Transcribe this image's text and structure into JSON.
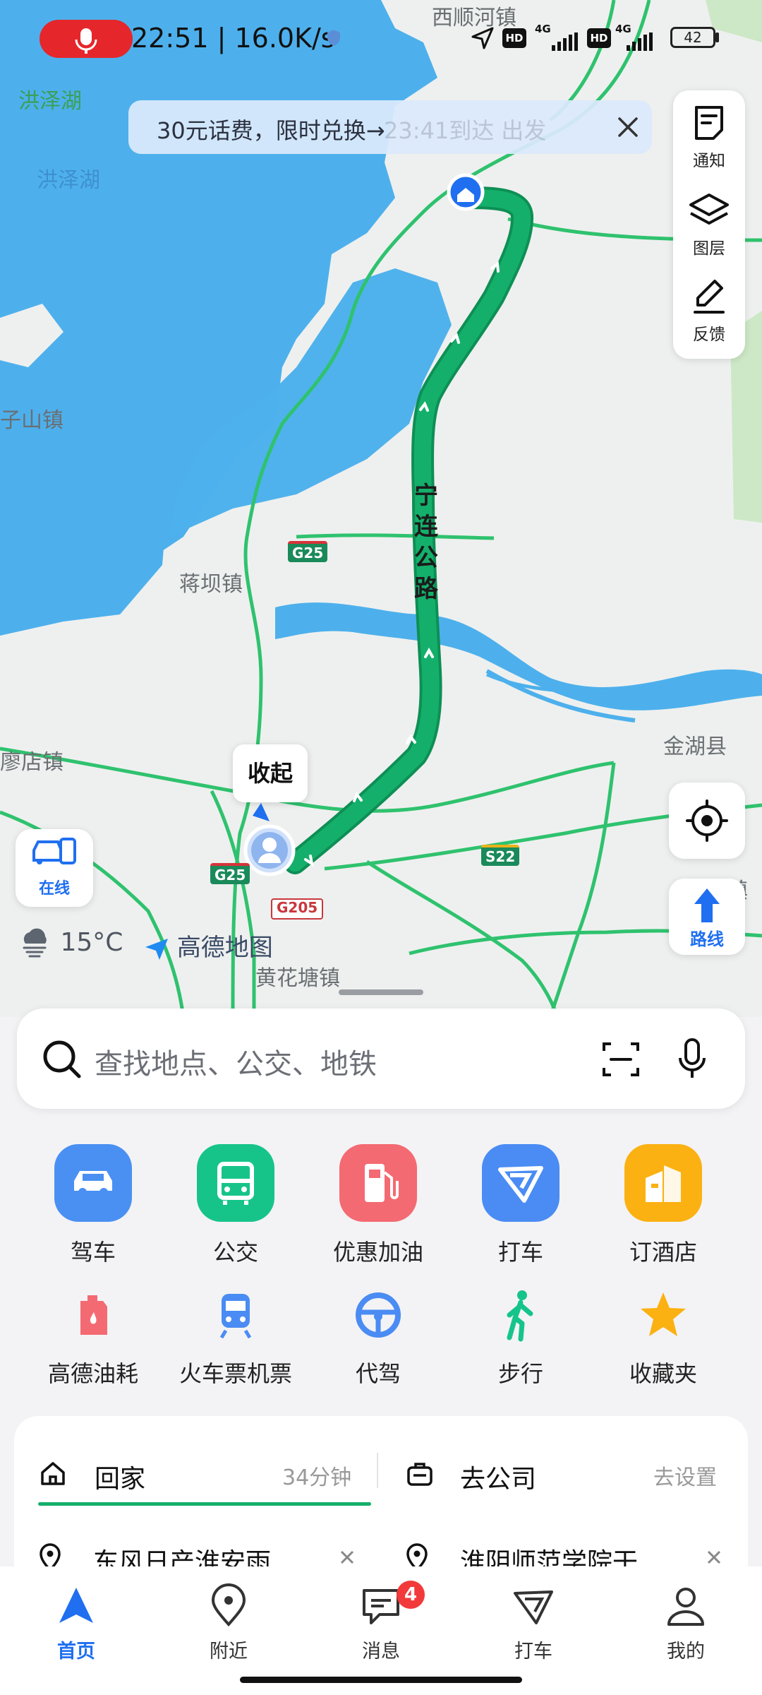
{
  "status_bar": {
    "time_speed": "22:51 | 16.0K/s",
    "network_1": "4G",
    "network_2": "4G",
    "hd_1": "HD",
    "hd_2": "HD",
    "battery": "42"
  },
  "promo": {
    "text": "30元话费，限时兑换→",
    "ghost_text": "23:41到达  出发"
  },
  "map": {
    "labels": {
      "xishunhe": "西顺河镇",
      "hongzehu_green": "洪泽湖",
      "hongzehu": "洪泽湖",
      "ziahan": "子山镇",
      "jiangba": "蒋坝镇",
      "miaodian": "廖店镇",
      "jinhu": "金湖县",
      "huanghuatang": "黄花塘镇",
      "qianjian": "前镇"
    },
    "road_name": [
      "宁",
      "连",
      "公",
      "路"
    ],
    "shields": {
      "g25_top": "G25",
      "g25_bottom": "G25",
      "s22": "S22",
      "g205": "G205"
    },
    "collapse_bubble": "收起",
    "colors": {
      "water": "#4db0ec",
      "route": "#14b06b",
      "route_edge": "#0e8f55",
      "road": "#2fc26e"
    }
  },
  "side_tools": {
    "notice": "通知",
    "layers": "图层",
    "feedback": "反馈",
    "route": "路线",
    "online": "在线"
  },
  "weather": {
    "temp": "15°C",
    "brand": "高德地图",
    "icon": "cloud-rain-icon"
  },
  "search": {
    "placeholder": "查找地点、公交、地铁"
  },
  "quick": {
    "row1": [
      {
        "label": "驾车",
        "icon": "car-icon",
        "color": "#4a90f2"
      },
      {
        "label": "公交",
        "icon": "bus-icon",
        "color": "#16c48a"
      },
      {
        "label": "优惠加油",
        "icon": "fuel-icon",
        "color": "#f46a72"
      },
      {
        "label": "打车",
        "icon": "taxi-icon",
        "color": "#4a8cf3"
      },
      {
        "label": "订酒店",
        "icon": "hotel-icon",
        "color": "#fbb112"
      }
    ],
    "row2": [
      {
        "label": "高德油耗",
        "icon": "fuel-can-icon",
        "color": "#f46a72"
      },
      {
        "label": "火车票机票",
        "icon": "train-icon",
        "color": "#4a8cf3"
      },
      {
        "label": "代驾",
        "icon": "steering-wheel-icon",
        "color": "#4a8cf3"
      },
      {
        "label": "步行",
        "icon": "walk-icon",
        "color": "#16c48a"
      },
      {
        "label": "收藏夹",
        "icon": "star-icon",
        "color": "#fbb112"
      }
    ]
  },
  "shortcuts": {
    "home": {
      "label": "回家",
      "eta": "34分钟",
      "recent": "东风日产淮安雨"
    },
    "work": {
      "label": "去公司",
      "action": "去设置",
      "recent": "淮阴师范学院干"
    }
  },
  "nav": {
    "items": [
      {
        "label": "首页",
        "icon": "home-nav-icon"
      },
      {
        "label": "附近",
        "icon": "location-pin-icon"
      },
      {
        "label": "消息",
        "icon": "message-icon"
      },
      {
        "label": "打车",
        "icon": "taxi-icon"
      },
      {
        "label": "我的",
        "icon": "user-icon"
      }
    ],
    "message_badge": "4",
    "active_color": "#1f6ff0"
  }
}
